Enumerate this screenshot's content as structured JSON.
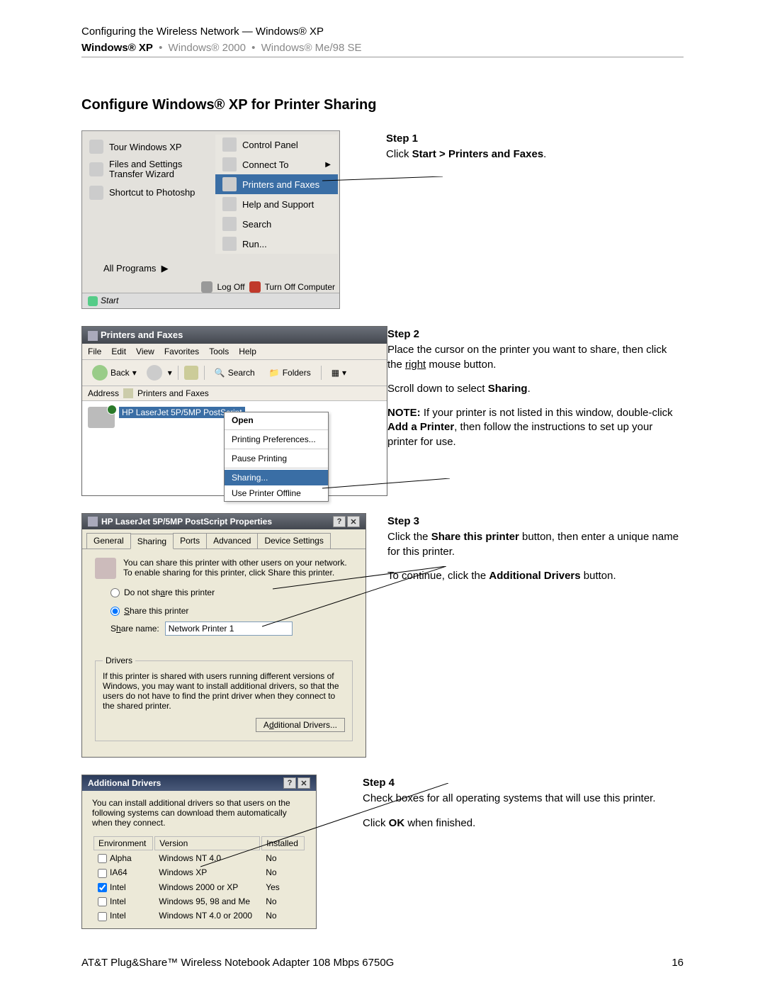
{
  "header": {
    "breadcrumb": "Configuring the Wireless Network — Windows® XP",
    "tabs": {
      "active": "Windows® XP",
      "t2": "Windows® 2000",
      "t3": "Windows® Me/98 SE"
    }
  },
  "title": "Configure Windows® XP for Printer Sharing",
  "step1": {
    "label": "Step 1",
    "text_pre": "Click ",
    "bold": "Start > Printers and Faxes",
    "text_post": "."
  },
  "startmenu": {
    "left": [
      "Tour Windows XP",
      "Files and Settings Transfer Wizard",
      "Shortcut to Photoshp"
    ],
    "all": "All Programs",
    "right": [
      {
        "label": "Control Panel",
        "arrow": false
      },
      {
        "label": "Connect To",
        "arrow": true
      },
      {
        "label": "Printers and Faxes",
        "arrow": false,
        "hl": true
      },
      {
        "label": "Help and Support",
        "arrow": false
      },
      {
        "label": "Search",
        "arrow": false
      },
      {
        "label": "Run...",
        "arrow": false
      }
    ],
    "logoff": "Log Off",
    "turnoff": "Turn Off Computer",
    "startbtn": "Start"
  },
  "step2": {
    "label": "Step 2",
    "p1a": "Place the cursor on the printer you want to share, then click the ",
    "p1u": "right",
    "p1b": " mouse button.",
    "p2a": "Scroll down to select ",
    "p2b": "Sharing",
    "p2c": ".",
    "note_label": "NOTE:",
    "note_a": " If your printer is not listed in this window, double-click ",
    "note_bold": "Add a Printer",
    "note_b": ", then follow the instructions to set up your printer for use."
  },
  "pfwin": {
    "title": "Printers and Faxes",
    "menus": [
      "File",
      "Edit",
      "View",
      "Favorites",
      "Tools",
      "Help"
    ],
    "tb_back": "Back",
    "tb_search": "Search",
    "tb_folders": "Folders",
    "addr_lbl": "Address",
    "addr_val": "Printers and Faxes",
    "printer_name": "HP LaserJet 5P/5MP PostScript",
    "ctx": [
      "Open",
      "Printing Preferences...",
      "Pause Printing",
      "Sharing...",
      "Use Printer Offline"
    ]
  },
  "step3": {
    "label": "Step 3",
    "p1a": "Click the ",
    "p1b": "Share this printer",
    "p1c": " button, then enter a unique name for this printer.",
    "p2a": "To continue, click the ",
    "p2b": "Additional Drivers",
    "p2c": " button."
  },
  "prop": {
    "title": "HP LaserJet 5P/5MP PostScript Properties",
    "tabs": [
      "General",
      "Sharing",
      "Ports",
      "Advanced",
      "Device Settings"
    ],
    "desc": "You can share this printer with other users on your network. To enable sharing for this printer, click Share this printer.",
    "r1": "Do not share this printer",
    "r2": "Share this printer",
    "sn_label": "Share name:",
    "sn_value": "Network Printer 1",
    "drivers_legend": "Drivers",
    "drivers_text": "If this printer is shared with users running different versions of Windows, you may want to install additional drivers, so that the users do not have to find the print driver when they connect to the shared printer.",
    "ad_btn": "Additional Drivers..."
  },
  "step4": {
    "label": "Step 4",
    "p1": "Check boxes for all operating systems that will use this printer.",
    "p2a": "Click ",
    "p2b": "OK",
    "p2c": " when finished."
  },
  "adlg": {
    "title": "Additional Drivers",
    "desc": "You can install additional drivers so that users on the following systems can download them automatically when they connect.",
    "cols": [
      "Environment",
      "Version",
      "Installed"
    ],
    "rows": [
      {
        "env": "Alpha",
        "ver": "Windows NT 4.0",
        "inst": "No",
        "chk": false
      },
      {
        "env": "IA64",
        "ver": "Windows XP",
        "inst": "No",
        "chk": false
      },
      {
        "env": "Intel",
        "ver": "Windows 2000 or XP",
        "inst": "Yes",
        "chk": true
      },
      {
        "env": "Intel",
        "ver": "Windows 95, 98 and Me",
        "inst": "No",
        "chk": false
      },
      {
        "env": "Intel",
        "ver": "Windows NT 4.0 or 2000",
        "inst": "No",
        "chk": false
      }
    ]
  },
  "footer": {
    "left": "AT&T Plug&Share™ Wireless Notebook Adapter 108 Mbps 6750G",
    "right": "16"
  }
}
